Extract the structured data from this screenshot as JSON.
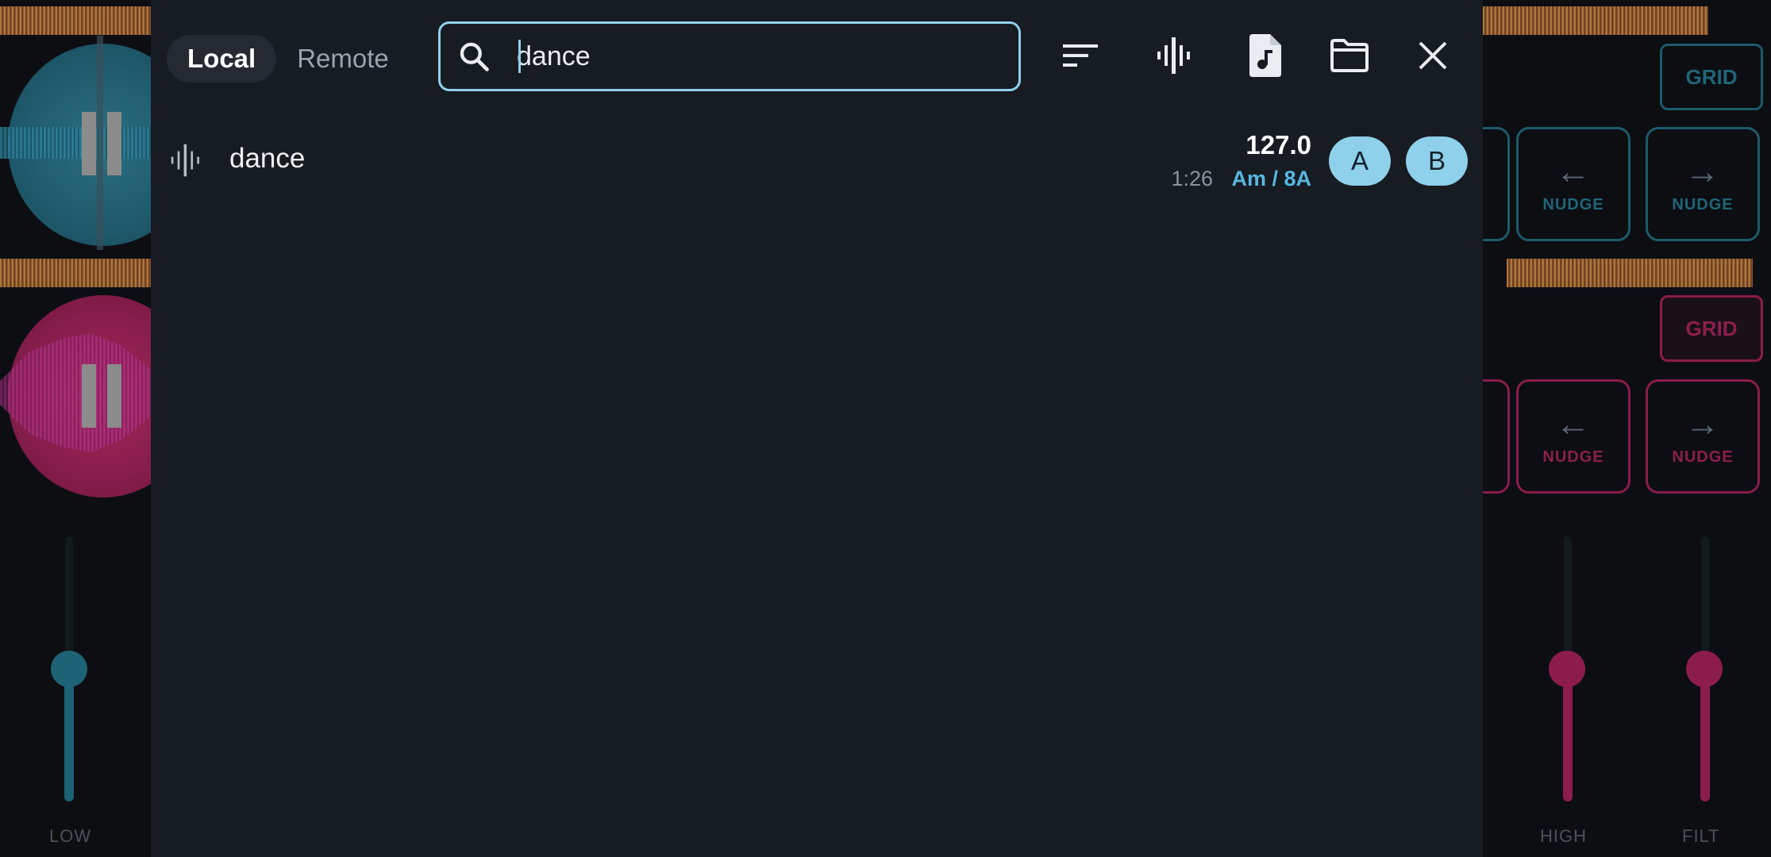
{
  "library": {
    "source_tabs": [
      {
        "label": "Local",
        "active": true
      },
      {
        "label": "Remote",
        "active": false
      }
    ],
    "search": {
      "value": "dance",
      "placeholder": ""
    },
    "toolbar_icons": [
      "sort-icon",
      "waveform-icon",
      "audio-file-icon",
      "folder-icon",
      "close-icon"
    ],
    "results": [
      {
        "title": "dance",
        "bpm": "127.0",
        "duration": "1:26",
        "key": "Am / 8A",
        "load_buttons": [
          "A",
          "B"
        ]
      }
    ]
  },
  "deck": {
    "grid_label": "GRID",
    "nudge_label": "NUDGE",
    "eq_labels": {
      "low": "LOW",
      "high": "HIGH",
      "filter": "FILT"
    }
  },
  "colors": {
    "accent": "#8fd0ea",
    "deck_a": "#1f6678",
    "deck_b": "#8c1f4b",
    "key_text": "#56b8e0",
    "panel_bg": "#171b22"
  }
}
